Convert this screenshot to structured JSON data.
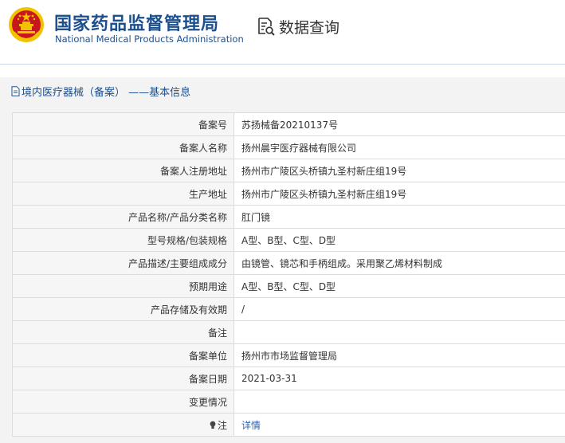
{
  "header": {
    "org_name_cn": "国家药品监督管理局",
    "org_name_en": "National Medical Products Administration",
    "query_label": "数据查询",
    "emblem_icon": "national-emblem-icon",
    "query_icon": "document-search-icon"
  },
  "panel": {
    "title": "境内医疗器械（备案） ——基本信息",
    "title_icon": "document-icon"
  },
  "rows": [
    {
      "label": "备案号",
      "value": "苏扬械备20210137号"
    },
    {
      "label": "备案人名称",
      "value": "扬州晨宇医疗器械有限公司"
    },
    {
      "label": "备案人注册地址",
      "value": "扬州市广陵区头桥镇九圣村新庄组19号"
    },
    {
      "label": "生产地址",
      "value": "扬州市广陵区头桥镇九圣村新庄组19号"
    },
    {
      "label": "产品名称/产品分类名称",
      "value": "肛门镜"
    },
    {
      "label": "型号规格/包装规格",
      "value": "A型、B型、C型、D型"
    },
    {
      "label": "产品描述/主要组成成分",
      "value": "由镜管、镜芯和手柄组成。采用聚乙烯材料制成"
    },
    {
      "label": "预期用途",
      "value": "A型、B型、C型、D型"
    },
    {
      "label": "产品存储及有效期",
      "value": "/"
    },
    {
      "label": "备注",
      "value": ""
    },
    {
      "label": "备案单位",
      "value": "扬州市市场监督管理局"
    },
    {
      "label": "备案日期",
      "value": "2021-03-31"
    },
    {
      "label": "变更情况",
      "value": ""
    }
  ],
  "note": {
    "label": "注",
    "link_text": "详情",
    "icon": "lightbulb-icon"
  },
  "colors": {
    "brand_blue": "#1c4f8e",
    "link_blue": "#2b63b8",
    "emblem_red": "#c8161d",
    "emblem_gold": "#f2c200"
  }
}
